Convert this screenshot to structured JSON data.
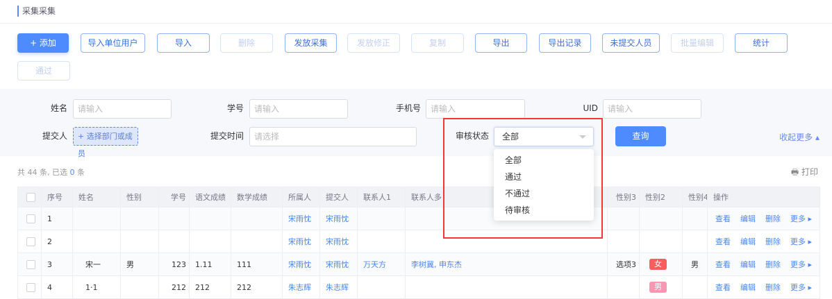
{
  "page_title": "采集采集",
  "colors": {
    "primary": "#4e8bff",
    "link": "#4b86f2",
    "tag_female": "#f95e5e",
    "tag_male": "#f797b4",
    "highlight": "#ff3333"
  },
  "toolbar": [
    {
      "label": "+ 添加",
      "type": "primary"
    },
    {
      "label": "导入单位用户",
      "type": "normal"
    },
    {
      "label": "导入",
      "type": "normal"
    },
    {
      "label": "删除",
      "type": "disabled"
    },
    {
      "label": "发放采集",
      "type": "normal"
    },
    {
      "label": "发放修正",
      "type": "disabled"
    },
    {
      "label": "复制",
      "type": "disabled"
    },
    {
      "label": "导出",
      "type": "normal"
    },
    {
      "label": "导出记录",
      "type": "normal"
    },
    {
      "label": "未提交人员",
      "type": "normal"
    },
    {
      "label": "批量编辑",
      "type": "disabled"
    },
    {
      "label": "统计",
      "type": "normal"
    },
    {
      "label": "通过",
      "type": "disabled"
    }
  ],
  "filters": {
    "name": {
      "label": "姓名",
      "placeholder": "请输入"
    },
    "student_id": {
      "label": "学号",
      "placeholder": "请输入"
    },
    "phone": {
      "label": "手机号",
      "placeholder": "请输入"
    },
    "uid": {
      "label": "UID",
      "placeholder": "请输入"
    },
    "submitter": {
      "label": "提交人",
      "button": "+ 选择部门或成员"
    },
    "submit_time": {
      "label": "提交时间",
      "placeholder": "请选择"
    },
    "review_status": {
      "label": "审核状态",
      "value": "全部",
      "options": [
        "全部",
        "通过",
        "不通过",
        "待审核"
      ]
    },
    "query": "查询",
    "collapse": "收起更多 ▴"
  },
  "summary": {
    "prefix": "共 44 条, 已选 ",
    "selected": "0",
    "suffix": " 条"
  },
  "print": "打印",
  "table": {
    "headers": [
      "",
      "序号",
      "姓名",
      "性别",
      "学号",
      "语文成绩",
      "数学成绩",
      "所属人",
      "提交人",
      "联系人1",
      "联系人多",
      "性别3",
      "性别2",
      "性别4",
      "操作"
    ],
    "actions": [
      "查看",
      "编辑",
      "删除",
      "更多 ▸"
    ],
    "rows": [
      {
        "no": "1",
        "name": "",
        "gender": "",
        "sid": "",
        "chinese": "",
        "math": "",
        "owner": "宋雨忱",
        "submitter": "宋雨忱",
        "contact1": "",
        "contacts": "",
        "gender3": "",
        "gender2": "",
        "gender4": ""
      },
      {
        "no": "2",
        "name": "",
        "gender": "",
        "sid": "",
        "chinese": "",
        "math": "",
        "owner": "宋雨忱",
        "submitter": "宋雨忱",
        "contact1": "",
        "contacts": "",
        "gender3": "",
        "gender2": "",
        "gender4": ""
      },
      {
        "no": "3",
        "name": "宋一",
        "gender": "男",
        "sid": "123",
        "chinese": "1.11",
        "math": "111",
        "owner": "宋雨忱",
        "submitter": "宋雨忱",
        "contact1": "万天方",
        "contacts": "李树冀, 申东杰",
        "gender3": "选项3",
        "gender2": "女",
        "gender4": "男"
      },
      {
        "no": "4",
        "name": "1·1",
        "gender": "",
        "sid": "212",
        "chinese": "212",
        "math": "212",
        "owner": "朱志辉",
        "submitter": "朱志辉",
        "contact1": "",
        "contacts": "",
        "gender3": "",
        "gender2": "男",
        "gender4": ""
      }
    ]
  }
}
